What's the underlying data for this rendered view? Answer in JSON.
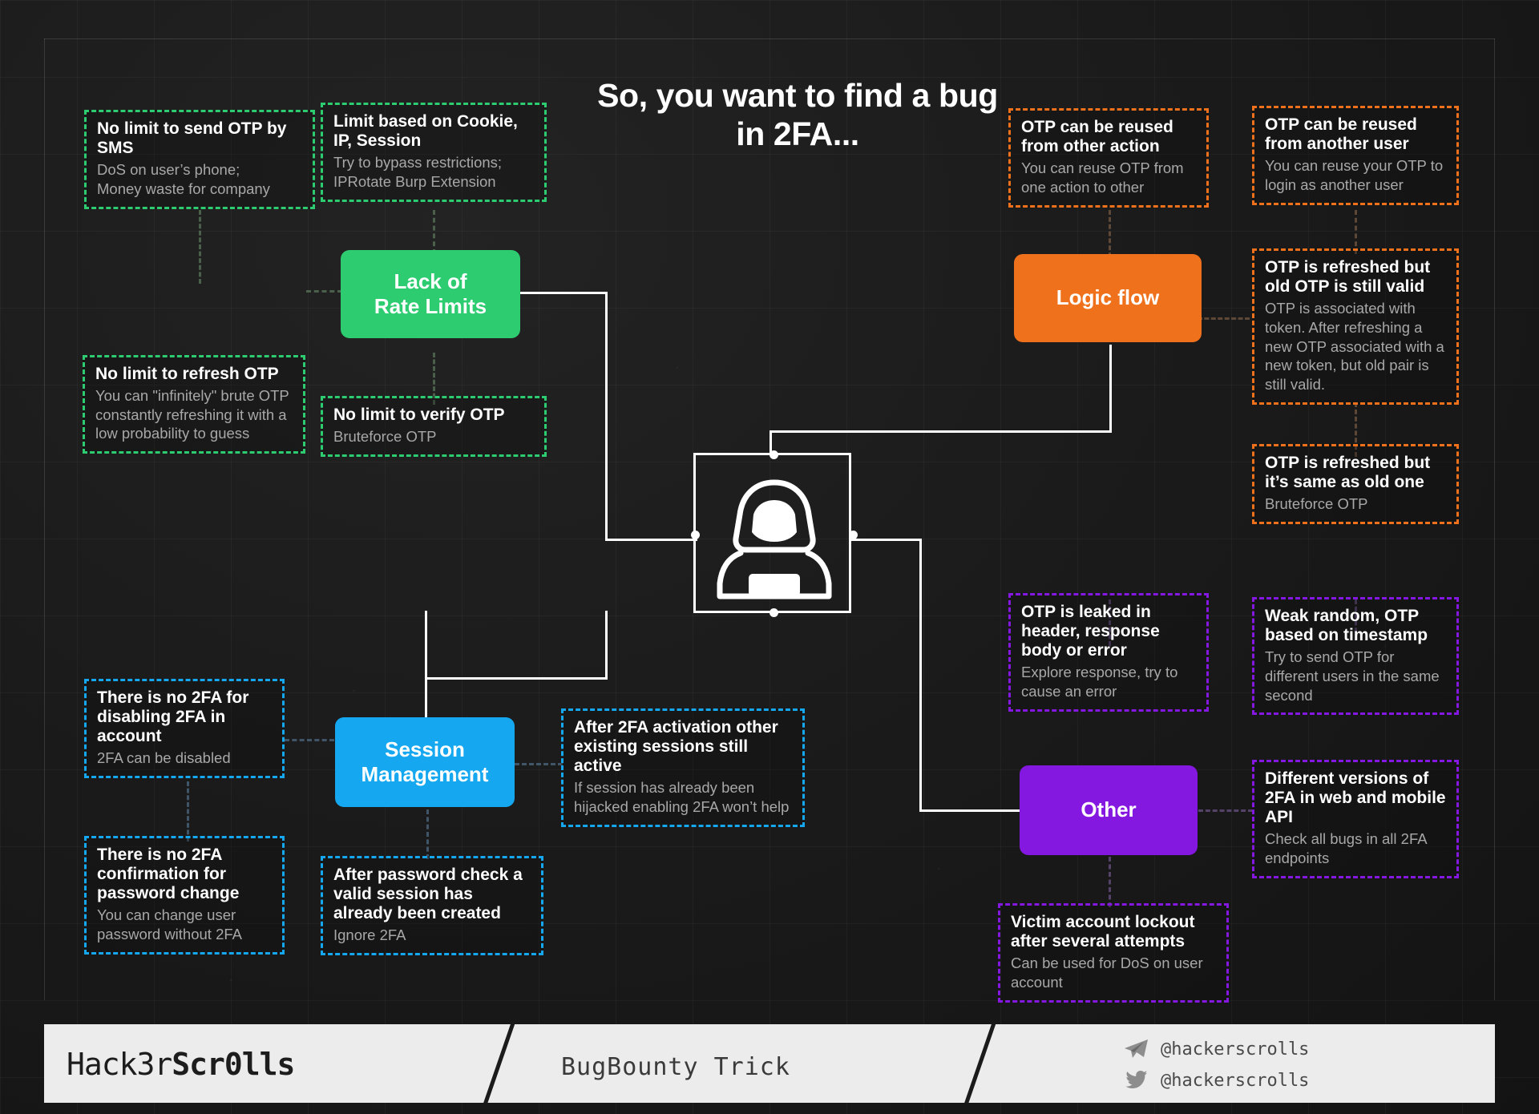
{
  "title": "So, you want to find a bug in 2FA...",
  "colors": {
    "rate_limits": "#2ecc71",
    "logic_flow": "#f0711c",
    "session_management": "#15a8f0",
    "other": "#8417e0",
    "background": "#1b1b1b",
    "footer_bg": "#ececec"
  },
  "center": {
    "icon": "hacker-hoodie-icon"
  },
  "categories": {
    "rate_limits": "Lack of\nRate Limits",
    "logic_flow": "Logic flow",
    "session_management": "Session\nManagement",
    "other": "Other"
  },
  "notes": {
    "n1": {
      "title": "No limit to send OTP by SMS",
      "desc": "DoS on user’s phone;\nMoney waste for company",
      "group": "rate_limits"
    },
    "n2": {
      "title": "Limit based on Cookie, IP, Session",
      "desc": "Try to bypass restrictions;\nIPRotate Burp Extension",
      "group": "rate_limits"
    },
    "n3": {
      "title": "No limit to refresh OTP",
      "desc": "You can \"infinitely\" brute OTP constantly refreshing it with a low probability to guess",
      "group": "rate_limits"
    },
    "n4": {
      "title": "No limit to verify OTP",
      "desc": "Bruteforce OTP",
      "group": "rate_limits"
    },
    "n5": {
      "title": "OTP can be reused from other action",
      "desc": "You can reuse OTP from one action to other",
      "group": "logic_flow"
    },
    "n6": {
      "title": "OTP can be reused from another user",
      "desc": "You can reuse your OTP to login as another user",
      "group": "logic_flow"
    },
    "n7": {
      "title": "OTP is refreshed but old OTP is still valid",
      "desc": "OTP is associated with token. After refreshing a new OTP associated with a new token, but old pair is still valid.",
      "group": "logic_flow"
    },
    "n8": {
      "title": "OTP is refreshed but it’s same as old one",
      "desc": "Bruteforce OTP",
      "group": "logic_flow"
    },
    "n9": {
      "title": "There is no 2FA for disabling 2FA in account",
      "desc": "2FA can be disabled",
      "group": "session_management"
    },
    "n10": {
      "title": "After 2FA activation other existing sessions still active",
      "desc": "If session has already been hijacked enabling 2FA won’t help",
      "group": "session_management"
    },
    "n11": {
      "title": "There is no 2FA confirmation for password change",
      "desc": "You can change user password without 2FA",
      "group": "session_management"
    },
    "n12": {
      "title": "After password check a valid session has already been created",
      "desc": "Ignore 2FA",
      "group": "session_management"
    },
    "n13": {
      "title": "OTP is leaked in header, response body or error",
      "desc": "Explore response, try to cause an error",
      "group": "other"
    },
    "n14": {
      "title": "Weak random, OTP based on timestamp",
      "desc": "Try to send OTP for different users in the same second",
      "group": "other"
    },
    "n15": {
      "title": "Different versions of 2FA in web and mobile API",
      "desc": "Check all bugs in all 2FA endpoints",
      "group": "other"
    },
    "n16": {
      "title": "Victim account lockout after several attempts",
      "desc": "Can be used for DoS on user account",
      "group": "other"
    }
  },
  "footer": {
    "brand_plain": "Hack3r",
    "brand_bold": "Scr0lls",
    "subtitle": "BugBounty Trick",
    "telegram_handle": "@hackerscrolls",
    "twitter_handle": "@hackerscrolls",
    "telegram_icon": "telegram-icon",
    "twitter_icon": "twitter-bird-icon"
  }
}
